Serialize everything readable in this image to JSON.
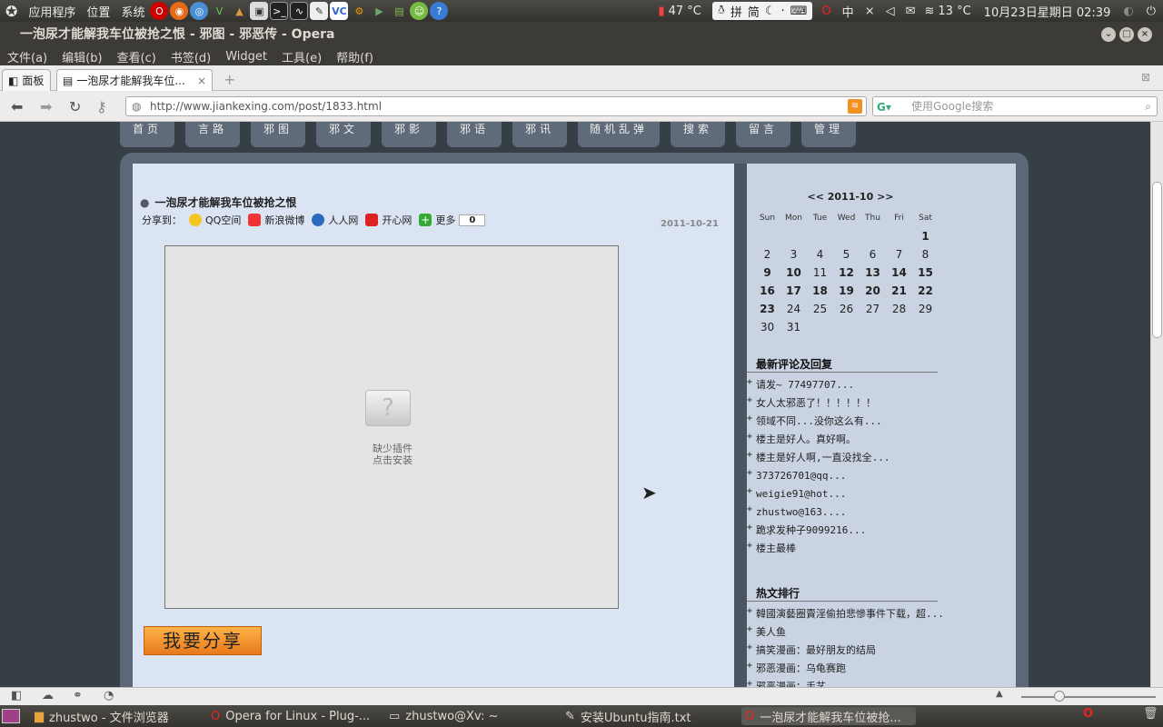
{
  "top_panel": {
    "menus": [
      "应用程序",
      "位置",
      "系统"
    ],
    "cpu_temp": "47 °C",
    "ime": {
      "mode1": "拼",
      "mode2": "简"
    },
    "ime_lang": "中",
    "weather": "13 °C",
    "datetime": "10月23日星期日 02:39"
  },
  "window": {
    "title": "一泡尿才能解我车位被抢之恨 - 邪图 - 邪恶传 - Opera"
  },
  "menubar": [
    "文件(a)",
    "编辑(b)",
    "查看(c)",
    "书签(d)",
    "Widget",
    "工具(e)",
    "帮助(f)"
  ],
  "tabs": {
    "panel_label": "面板",
    "active_title": "一泡尿才能解我车位..."
  },
  "address": {
    "url": "http://www.jiankexing.com/post/1833.html",
    "search_placeholder": "使用Google搜索"
  },
  "site_nav": [
    "首页",
    "言路",
    "邪图",
    "邪文",
    "邪影",
    "邪语",
    "邪讯",
    "随机乱弹",
    "搜索",
    "留言",
    "管理"
  ],
  "post": {
    "title": "一泡尿才能解我车位被抢之恨",
    "share_label": "分享到：",
    "share_items": [
      "QQ空间",
      "新浪微博",
      "人人网",
      "开心网",
      "更多"
    ],
    "share_count": "0",
    "date": "2011-10-21",
    "plugin_text_1": "缺少插件",
    "plugin_text_2": "点击安装",
    "share_button": "我要分享"
  },
  "calendar": {
    "header": "<< 2011-10 >>",
    "weekdays": [
      "Sun",
      "Mon",
      "Tue",
      "Wed",
      "Thu",
      "Fri",
      "Sat"
    ],
    "weeks": [
      [
        "",
        "",
        "",
        "",
        "",
        "",
        "1"
      ],
      [
        "2",
        "3",
        "4",
        "5",
        "6",
        "7",
        "8"
      ],
      [
        "9",
        "10",
        "11",
        "12",
        "13",
        "14",
        "15"
      ],
      [
        "16",
        "17",
        "18",
        "19",
        "20",
        "21",
        "22"
      ],
      [
        "23",
        "24",
        "25",
        "26",
        "27",
        "28",
        "29"
      ],
      [
        "30",
        "31",
        "",
        "",
        "",
        "",
        ""
      ]
    ],
    "bold_days": [
      "1",
      "9",
      "10",
      "12",
      "13",
      "14",
      "15",
      "16",
      "17",
      "18",
      "19",
      "20",
      "21",
      "22",
      "23"
    ]
  },
  "recent_comments": {
    "heading": "最新评论及回复",
    "items": [
      "请发~ 77497707...",
      "女人太邪恶了！！！！！！",
      "领域不同...没你这么有...",
      "楼主是好人。真好啊。",
      "楼主是好人啊,一直没找全...",
      "373726701@qq...",
      "weigie91@hot...",
      "zhustwo@163....",
      "跪求发种子9099216...",
      "楼主最棒"
    ]
  },
  "hot_posts": {
    "heading": "热文排行",
    "items": [
      "韓國演藝圈賣淫偷拍悲慘事件下载，超...",
      "美人鱼",
      "搞笑漫画：最好朋友的结局",
      "邪恶漫画：乌龟赛跑",
      "邪恶漫画：手艺"
    ]
  },
  "taskbar": {
    "items": [
      "zhustwo - 文件浏览器",
      "Opera for Linux - Plug-...",
      "zhustwo@Xv: ~",
      "安装Ubuntu指南.txt",
      "一泡尿才能解我车位被抢..."
    ]
  },
  "colors": {
    "panel": "#3c3b37",
    "page_bg": "#363e46",
    "post_bg": "#dbe4f3",
    "sidebar_bg": "#c9d3e2",
    "share_button": "#f0962e"
  }
}
